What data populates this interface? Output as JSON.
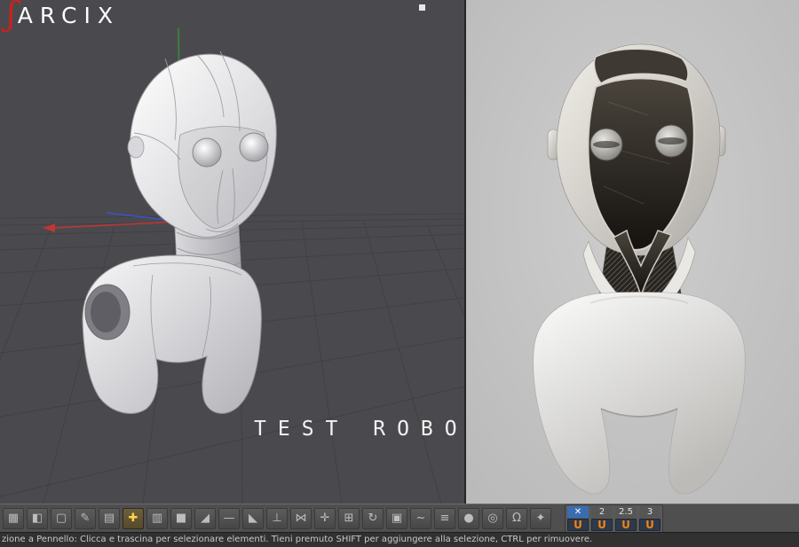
{
  "left_viewport": {
    "logo_glyph": "ʃ",
    "logo_text": "ARCIX",
    "caption": "TEST ROBOT"
  },
  "toolbar": {
    "icons": [
      {
        "name": "grid-array-tool",
        "glyph": "▦"
      },
      {
        "name": "cube-tool",
        "glyph": "◧"
      },
      {
        "name": "marquee-tool",
        "glyph": "▢"
      },
      {
        "name": "brush-tool",
        "glyph": "✎"
      },
      {
        "name": "pattern-tool",
        "glyph": "▤"
      },
      {
        "name": "add-cube-tool",
        "glyph": "✚",
        "highlight": true
      },
      {
        "name": "columns-tool",
        "glyph": "▥"
      },
      {
        "name": "solid-cube-tool",
        "glyph": "■"
      },
      {
        "name": "prism-tool",
        "glyph": "◢"
      },
      {
        "name": "edge-tool",
        "glyph": "—"
      },
      {
        "name": "ramp-tool",
        "glyph": "◣"
      },
      {
        "name": "pin-tool",
        "glyph": "⊥"
      },
      {
        "name": "mirror-tool",
        "glyph": "⋈"
      },
      {
        "name": "move-tool",
        "glyph": "✛"
      },
      {
        "name": "bounds-tool",
        "glyph": "⊞"
      },
      {
        "name": "rotate-tool",
        "glyph": "↻"
      },
      {
        "name": "frame-tool",
        "glyph": "▣"
      },
      {
        "name": "spline-tool",
        "glyph": "~"
      },
      {
        "name": "list-tool",
        "glyph": "≡"
      },
      {
        "name": "sphere-tool",
        "glyph": "●"
      },
      {
        "name": "rings-tool",
        "glyph": "◎"
      },
      {
        "name": "magnet-tool",
        "glyph": "Ω"
      },
      {
        "name": "tweak-tool",
        "glyph": "✦"
      }
    ],
    "snap": {
      "columns": [
        {
          "top": "✕",
          "top_type": "x",
          "top_name": "snap-clear-button",
          "magnet": "U"
        },
        {
          "top": "2",
          "top_type": "num",
          "top_name": "snap-preset-2-button",
          "magnet": "U"
        },
        {
          "top": "2.5",
          "top_type": "num",
          "top_name": "snap-preset-2-5-button",
          "magnet": "U"
        },
        {
          "top": "3",
          "top_type": "num",
          "top_name": "snap-preset-3-button",
          "magnet": "U"
        }
      ]
    }
  },
  "statusbar": {
    "text": "zione a Pennello: Clicca e trascina per selezionare elementi.  Tieni premuto SHIFT per aggiungere alla selezione, CTRL per rimuovere."
  },
  "colors": {
    "logo_red": "#cf1f1f",
    "accent_orange": "#f08418",
    "snap_blue": "#3a6db0",
    "viewport_dark": "#4a4a4e",
    "viewport_light": "#c6c6c6"
  }
}
